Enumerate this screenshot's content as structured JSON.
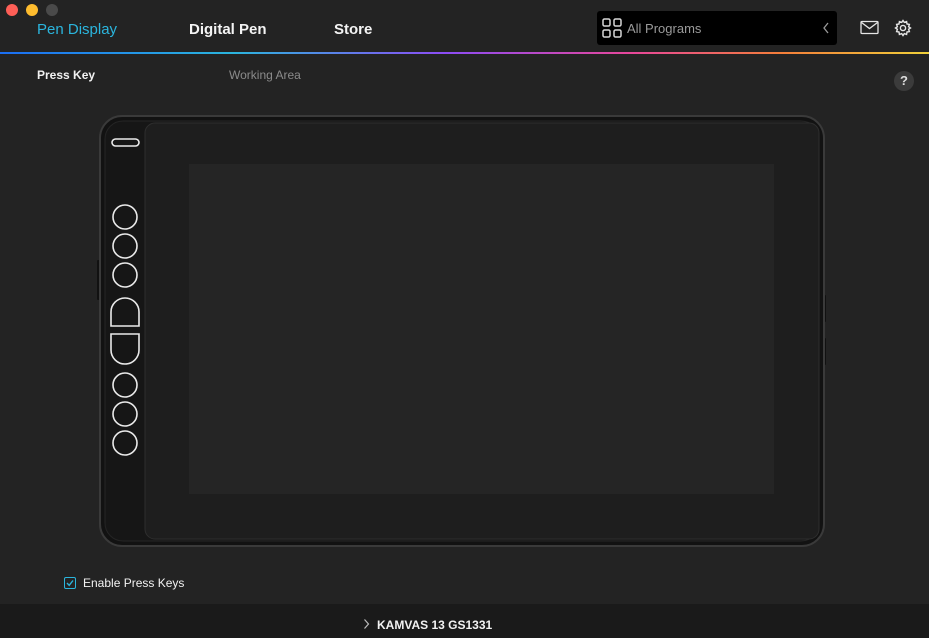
{
  "window": {
    "controls": [
      "close",
      "minimize",
      "maximize"
    ]
  },
  "nav": {
    "tabs": [
      {
        "label": "Pen Display",
        "active": true
      },
      {
        "label": "Digital Pen",
        "active": false
      },
      {
        "label": "Store",
        "active": false
      }
    ]
  },
  "header": {
    "program_selector": {
      "label": "All Programs",
      "icon": "grid-icon",
      "chevron": "chevron-left-icon"
    },
    "mail_icon": "mail-icon",
    "settings_icon": "gear-icon"
  },
  "subtabs": [
    {
      "label": "Press Key",
      "active": true
    },
    {
      "label": "Working Area",
      "active": false
    }
  ],
  "help": {
    "label": "?"
  },
  "tablet": {
    "press_keys": [
      "key-1",
      "key-2",
      "key-3",
      "key-4-top",
      "key-5-bottom",
      "key-6",
      "key-7",
      "key-8"
    ]
  },
  "options": {
    "enable_press_keys": {
      "label": "Enable Press Keys",
      "checked": true
    }
  },
  "footer": {
    "device_name": "KAMVAS 13 GS1331"
  },
  "colors": {
    "accent": "#2bb5dd",
    "background": "#232323",
    "footer": "#1a1a1a"
  }
}
